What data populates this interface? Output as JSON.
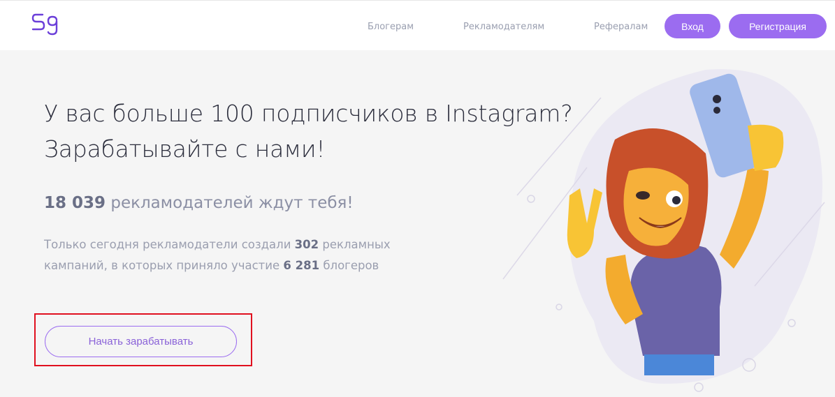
{
  "header": {
    "logo_text": "Sg",
    "nav": {
      "bloggers": "Блогерам",
      "advertisers": "Рекламодателям",
      "referrals": "Рефералам"
    },
    "login_label": "Вход",
    "register_label": "Регистрация"
  },
  "hero": {
    "headline_line1": "У вас больше 100 подписчиков в Instagram?",
    "headline_line2": "Зарабатывайте с нами!",
    "advertisers_count": "18 039",
    "advertisers_text": "рекламодателей ждут тебя!",
    "desc_part1": "Только сегодня рекламодатели создали",
    "campaigns_count": "302",
    "desc_part2": "рекламных кампаний, в которых приняло участие",
    "bloggers_count": "6 281",
    "desc_part3": "блогеров",
    "cta_label": "Начать зарабатывать"
  },
  "colors": {
    "accent": "#9b6cf0",
    "highlight": "#e0101f",
    "background": "#f5f5f5"
  },
  "icons": [
    "logo-icon",
    "lion-mascot-illustration"
  ]
}
